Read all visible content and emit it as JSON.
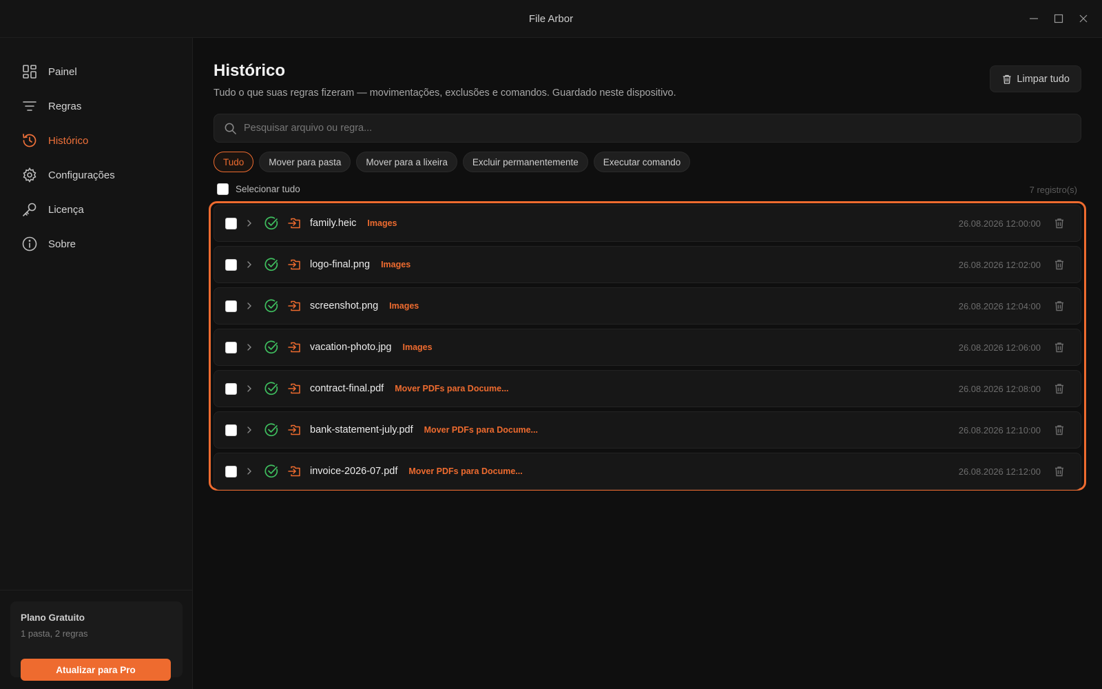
{
  "window": {
    "title": "File Arbor"
  },
  "sidebar": {
    "items": [
      {
        "label": "Painel",
        "icon": "dashboard-icon"
      },
      {
        "label": "Regras",
        "icon": "filter-icon"
      },
      {
        "label": "Histórico",
        "icon": "history-icon",
        "active": true
      },
      {
        "label": "Configurações",
        "icon": "gear-icon"
      },
      {
        "label": "Licença",
        "icon": "key-icon"
      },
      {
        "label": "Sobre",
        "icon": "info-icon"
      }
    ],
    "plan": {
      "title": "Plano Gratuito",
      "subtitle": "1 pasta, 2 regras",
      "upgrade_label": "Atualizar para Pro"
    }
  },
  "main": {
    "title": "Histórico",
    "subtitle": "Tudo o que suas regras fizeram — movimentações, exclusões e comandos. Guardado neste dispositivo.",
    "clear_all_label": "Limpar tudo",
    "search": {
      "placeholder": "Pesquisar arquivo ou regra...",
      "value": ""
    },
    "filters": [
      {
        "label": "Tudo",
        "active": true
      },
      {
        "label": "Mover para pasta"
      },
      {
        "label": "Mover para a lixeira"
      },
      {
        "label": "Excluir permanentemente"
      },
      {
        "label": "Executar comando"
      }
    ],
    "select_all_label": "Selecionar tudo",
    "record_count": "7 registro(s)",
    "records": [
      {
        "file": "family.heic",
        "rule": "Images",
        "time": "26.08.2026 12:00:00"
      },
      {
        "file": "logo-final.png",
        "rule": "Images",
        "time": "26.08.2026 12:02:00"
      },
      {
        "file": "screenshot.png",
        "rule": "Images",
        "time": "26.08.2026 12:04:00"
      },
      {
        "file": "vacation-photo.jpg",
        "rule": "Images",
        "time": "26.08.2026 12:06:00"
      },
      {
        "file": "contract-final.pdf",
        "rule": "Mover PDFs para Docume...",
        "time": "26.08.2026 12:08:00"
      },
      {
        "file": "bank-statement-july.pdf",
        "rule": "Mover PDFs para Docume...",
        "time": "26.08.2026 12:10:00"
      },
      {
        "file": "invoice-2026-07.pdf",
        "rule": "Mover PDFs para Docume...",
        "time": "26.08.2026 12:12:00"
      }
    ]
  },
  "colors": {
    "accent": "#ee6b2f",
    "success": "#3fbf5f",
    "background": "#0f0f0f"
  }
}
